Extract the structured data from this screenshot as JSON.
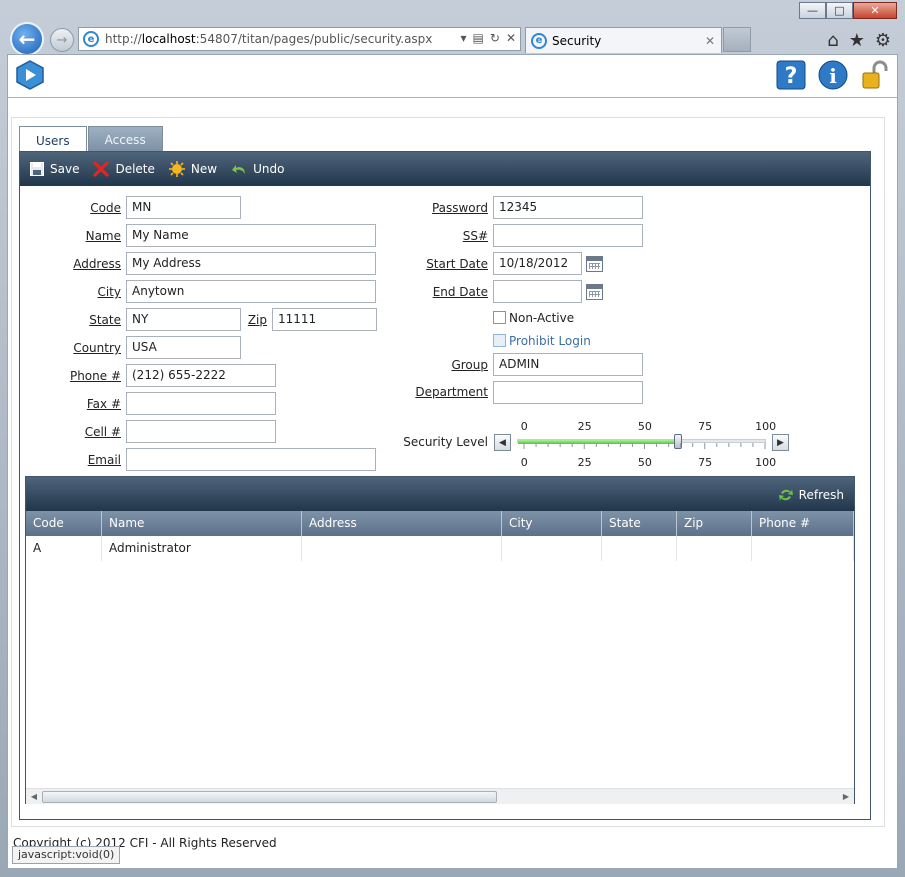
{
  "browser": {
    "url_prefix": "http://",
    "url_host": "localhost",
    "url_rest": ":54807/titan/pages/public/security.aspx",
    "tab_title": "Security",
    "tab_close": "✕",
    "status_text": "javascript:void(0)"
  },
  "tabs": [
    {
      "label": "Users",
      "active": true
    },
    {
      "label": "Access",
      "active": false
    }
  ],
  "toolbar": {
    "save": "Save",
    "delete": "Delete",
    "new": "New",
    "undo": "Undo"
  },
  "form": {
    "code": {
      "label": "Code",
      "value": "MN"
    },
    "name": {
      "label": "Name",
      "value": "My Name"
    },
    "address": {
      "label": "Address",
      "value": "My Address"
    },
    "city": {
      "label": "City",
      "value": "Anytown"
    },
    "state": {
      "label": "State",
      "value": "NY"
    },
    "zip": {
      "label": "Zip",
      "value": "11111"
    },
    "country": {
      "label": "Country",
      "value": "USA"
    },
    "phone": {
      "label": "Phone #",
      "value": "(212) 655-2222"
    },
    "fax": {
      "label": "Fax #",
      "value": ""
    },
    "cell": {
      "label": "Cell #",
      "value": ""
    },
    "email": {
      "label": "Email",
      "value": ""
    },
    "password": {
      "label": "Password",
      "value": "12345"
    },
    "ss": {
      "label": "SS#",
      "value": ""
    },
    "start_date": {
      "label": "Start Date",
      "value": "10/18/2012"
    },
    "end_date": {
      "label": "End Date",
      "value": ""
    },
    "non_active": {
      "label": "Non-Active",
      "checked": false
    },
    "prohibit_login": {
      "label": "Prohibit Login",
      "checked": false
    },
    "group": {
      "label": "Group",
      "value": "ADMIN"
    },
    "department": {
      "label": "Department",
      "value": ""
    },
    "security_level": {
      "label": "Security Level",
      "ticks": [
        "0",
        "25",
        "50",
        "75",
        "100"
      ],
      "value": 64
    }
  },
  "grid": {
    "refresh": "Refresh",
    "columns": [
      "Code",
      "Name",
      "Address",
      "City",
      "State",
      "Zip",
      "Phone #"
    ],
    "rows": [
      [
        "A",
        "Administrator",
        "",
        "",
        "",
        "",
        ""
      ]
    ]
  },
  "footer": "Copyright (c) 2012 CFI - All Rights Reserved",
  "colors": {
    "toolbar": "#2d4258",
    "slider_fill": "#4fc73a",
    "accent": "#1f5fb5"
  }
}
